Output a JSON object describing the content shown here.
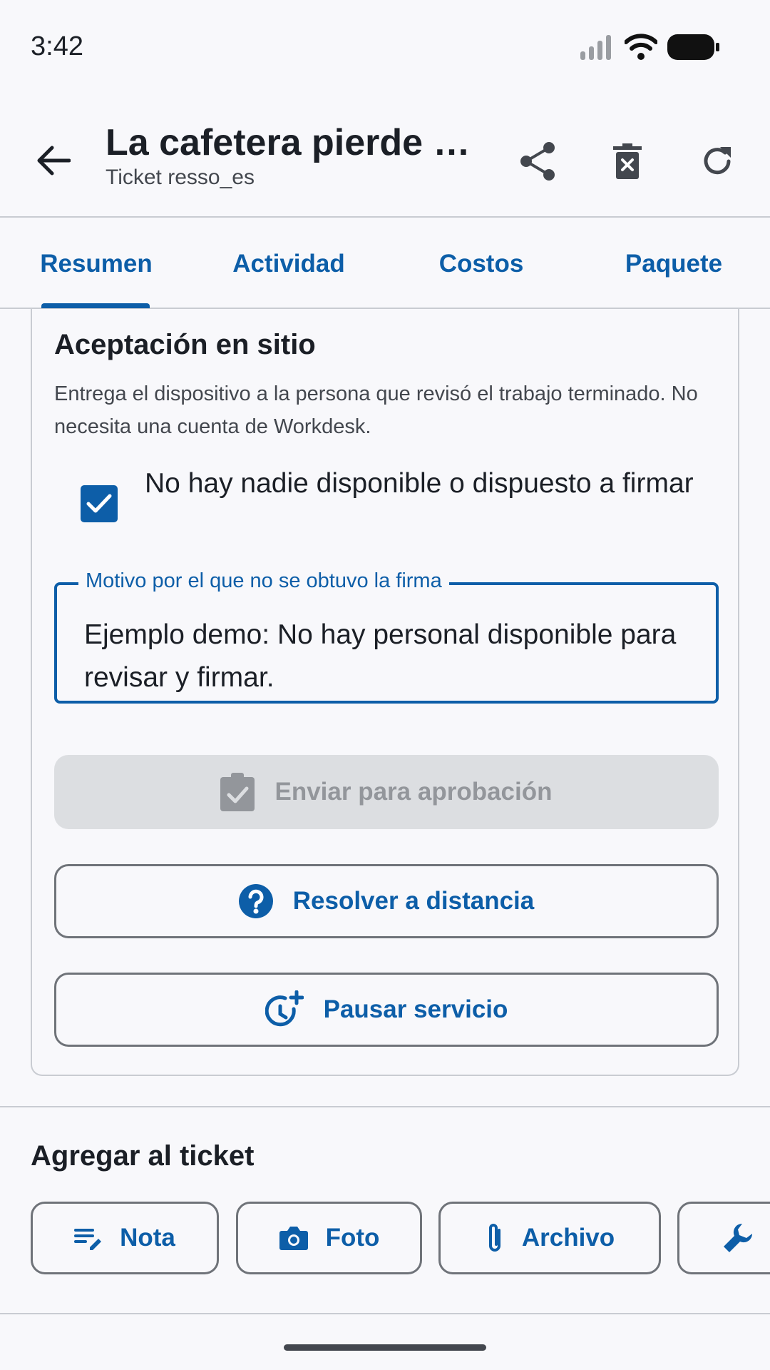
{
  "status_bar": {
    "time": "3:42"
  },
  "app_bar": {
    "title": "La cafetera pierde presión",
    "subtitle": "Ticket resso_es"
  },
  "tabs": [
    {
      "label": "Resumen",
      "selected": true
    },
    {
      "label": "Actividad",
      "selected": false
    },
    {
      "label": "Costos",
      "selected": false
    },
    {
      "label": "Paquete",
      "selected": false
    }
  ],
  "acceptance": {
    "title": "Aceptación en sitio",
    "description": "Entrega el dispositivo a la persona que revisó el trabajo terminado. No necesita una cuenta de Workdesk.",
    "checkbox_label": "No hay nadie disponible o dispuesto a firmar",
    "checkbox_checked": true,
    "reason_label": "Motivo por el que no se obtuvo la firma",
    "reason_value": "Ejemplo demo: No hay personal disponible para revisar y firmar.",
    "submit_label": "Enviar para aprobación",
    "resolve_remote_label": "Resolver a distancia",
    "pause_label": "Pausar servicio"
  },
  "add_to_ticket": {
    "title": "Agregar al ticket",
    "chips": [
      {
        "label": "Nota",
        "icon": "note-edit-icon"
      },
      {
        "label": "Foto",
        "icon": "camera-icon"
      },
      {
        "label": "Archivo",
        "icon": "paperclip-icon"
      },
      {
        "label": "",
        "icon": "wrench-icon"
      }
    ]
  },
  "colors": {
    "primary": "#0d5ea8",
    "background": "#f8f8fb",
    "disabled_bg": "#dcdee1",
    "disabled_text": "#93969b",
    "outline": "#6f7379"
  }
}
